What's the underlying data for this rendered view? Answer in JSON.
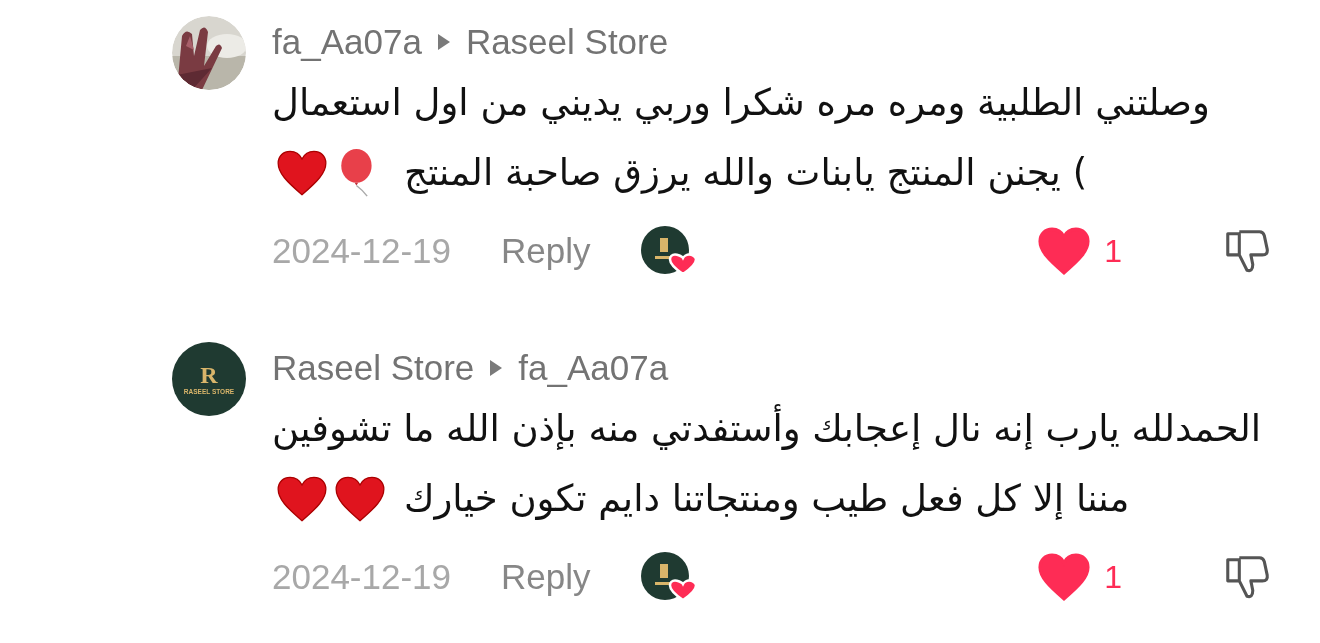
{
  "comments": [
    {
      "author": "fa_Aa07a",
      "reply_to": "Raseel Store",
      "lines": [
        "وصلتني الطلبية ومره مره شكرا وربي يديني من اول استعمال",
        ") يجنن المنتج يابنات والله يرزق صاحبة المنتج"
      ],
      "emojis": [
        {
          "kind": "balloon"
        },
        {
          "kind": "heart"
        }
      ],
      "date": "2024-12-19",
      "reply": "Reply",
      "creator_liked": true,
      "liked": true,
      "likes": "1"
    },
    {
      "avatar": {
        "kind": "logo",
        "letter": "R",
        "caption": "RASEEL STORE"
      },
      "author": "Raseel Store",
      "reply_to": "fa_Aa07a",
      "lines": [
        "الحمدلله يارب إنه نال إعجابك وأستفدتي منه بإذن الله ما تشوفين",
        "مننا إلا كل فعل طيب ومنتجاتنا دايم تكون خيارك"
      ],
      "emojis": [
        {
          "kind": "heart"
        },
        {
          "kind": "heart"
        }
      ],
      "date": "2024-12-19",
      "reply": "Reply",
      "creator_liked": true,
      "liked": true,
      "likes": "1"
    }
  ]
}
